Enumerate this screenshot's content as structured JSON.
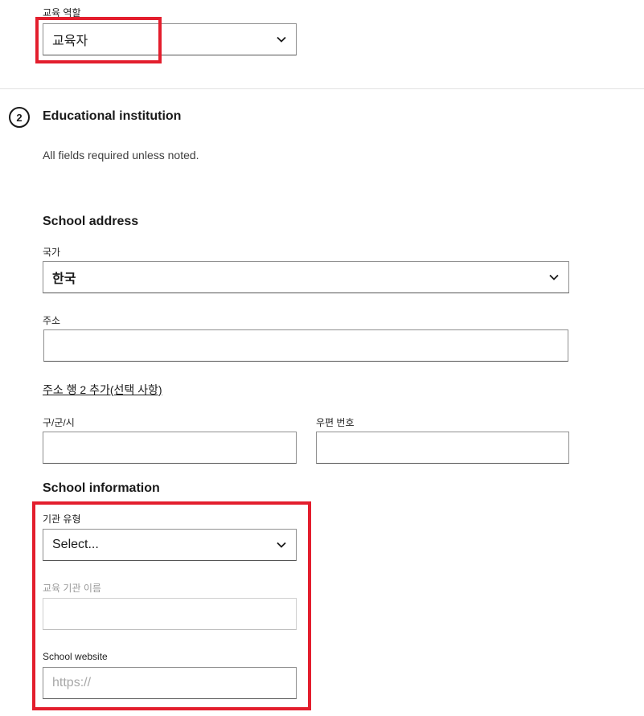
{
  "role_section": {
    "label": "교육 역할",
    "selected": "교육자"
  },
  "step": {
    "number": "2",
    "title": "Educational institution",
    "helper": "All fields required unless noted."
  },
  "school_address": {
    "heading": "School address",
    "country_label": "국가",
    "country_value": "한국",
    "address_label": "주소",
    "address_value": "",
    "add_line2_link": "주소 행 2 추가(선택 사항)",
    "city_label": "구/군/시",
    "city_value": "",
    "postal_label": "우편 번호",
    "postal_value": ""
  },
  "school_information": {
    "heading": "School information",
    "type_label": "기관 유형",
    "type_value": "Select...",
    "name_label": "교육 기관 이름",
    "name_value": "",
    "website_label": "School website",
    "website_placeholder": "https://"
  },
  "colors": {
    "highlight": "#e31e2d",
    "border": "#8f8f8f",
    "text": "#1a1a1a"
  }
}
